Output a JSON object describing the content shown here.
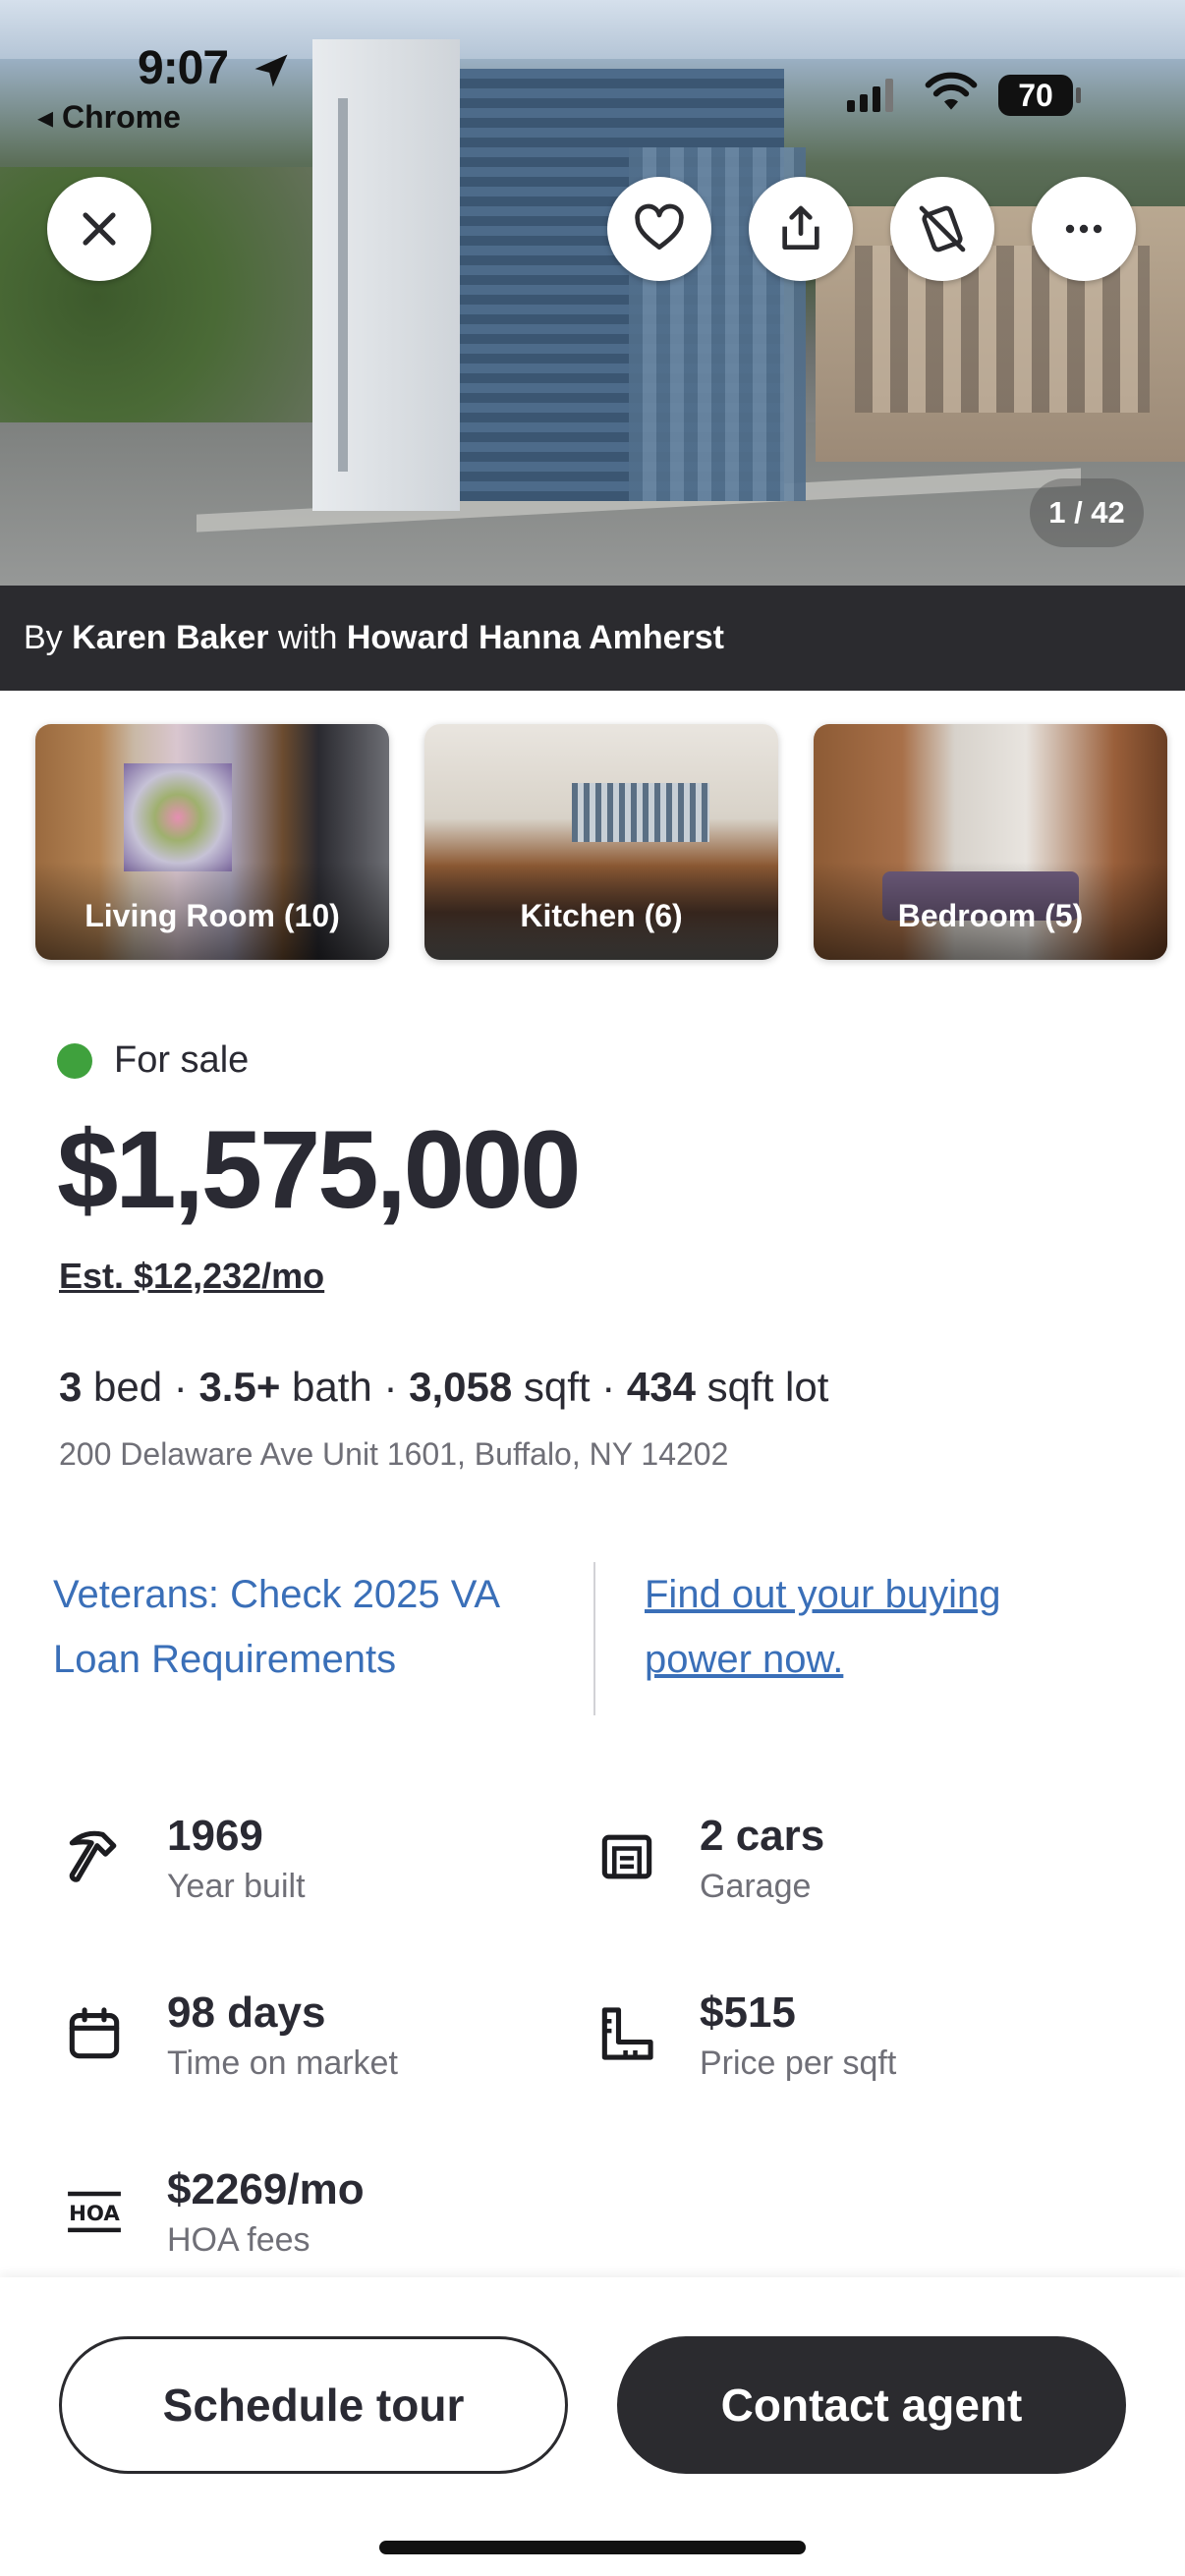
{
  "status_bar": {
    "time": "9:07",
    "back_label": "◂ Chrome",
    "battery": "70"
  },
  "hero": {
    "photo_counter": "1 / 42",
    "attribution": {
      "by": "By",
      "agent": "Karen Baker",
      "with": "with",
      "brokerage": "Howard Hanna Amherst"
    }
  },
  "thumbnails": [
    {
      "label": "Living Room (10)"
    },
    {
      "label": "Kitchen (6)"
    },
    {
      "label": "Bedroom (5)"
    }
  ],
  "listing": {
    "status": "For sale",
    "status_color": "#3fa13d",
    "price": "$1,575,000",
    "estimate": "Est. $12,232/mo",
    "beds": "3",
    "beds_unit": "bed",
    "baths": "3.5+",
    "baths_unit": "bath",
    "sqft": "3,058",
    "sqft_unit": "sqft",
    "lot": "434",
    "lot_unit": "sqft lot",
    "address": "200 Delaware Ave Unit 1601, Buffalo, NY 14202"
  },
  "links": {
    "va_loan": "Veterans: Check 2025 VA Loan Requirements",
    "buying_power": "Find out your buying power now.",
    "color": "#3a6fb8"
  },
  "facts": {
    "year_built": {
      "value": "1969",
      "label": "Year built",
      "icon": "hammer-icon"
    },
    "garage": {
      "value": "2 cars",
      "label": "Garage",
      "icon": "garage-icon"
    },
    "time_on_market": {
      "value": "98 days",
      "label": "Time on market",
      "icon": "calendar-icon"
    },
    "price_per_sqft": {
      "value": "$515",
      "label": "Price per sqft",
      "icon": "ruler-icon"
    },
    "hoa": {
      "value": "$2269/mo",
      "label": "HOA fees",
      "icon": "hoa-icon",
      "icon_text": "HOA"
    }
  },
  "actions": {
    "schedule_tour": "Schedule tour",
    "contact_agent": "Contact agent"
  }
}
